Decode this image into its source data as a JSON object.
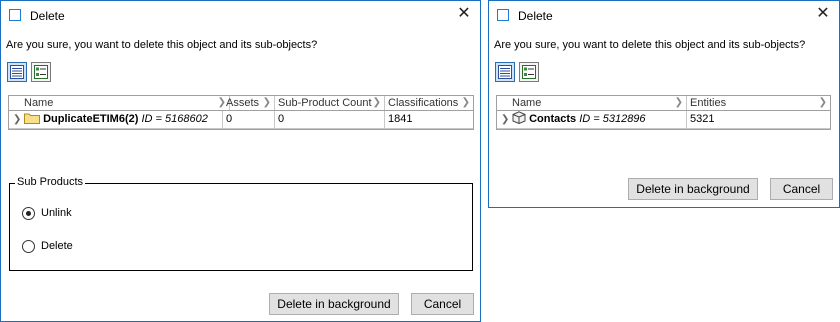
{
  "dialog1": {
    "title": "Delete",
    "question": "Are you sure, you want to delete this object and its sub-objects?",
    "columns": [
      "Name",
      "Assets",
      "Sub-Product Count",
      "Classifications"
    ],
    "row": {
      "name": "DuplicateETIM6(2)",
      "id_text": "ID = 5168602",
      "assets": "0",
      "sub_product_count": "0",
      "classifications": "1841"
    },
    "sub_products": {
      "legend": "Sub Products",
      "options": [
        "Unlink",
        "Delete"
      ],
      "selected": "Unlink"
    },
    "buttons": {
      "delete_bg": "Delete in background",
      "cancel": "Cancel"
    }
  },
  "dialog2": {
    "title": "Delete",
    "question": "Are you sure, you want to delete this object and its sub-objects?",
    "columns": [
      "Name",
      "Entities"
    ],
    "row": {
      "name": "Contacts",
      "id_text": "ID = 5312896",
      "entities": "5321"
    },
    "buttons": {
      "delete_bg": "Delete in background",
      "cancel": "Cancel"
    }
  },
  "colors": {
    "border": "#1a6fc0",
    "selected_toolbar": "#cfe3f7",
    "button": "#e1e1e1"
  }
}
